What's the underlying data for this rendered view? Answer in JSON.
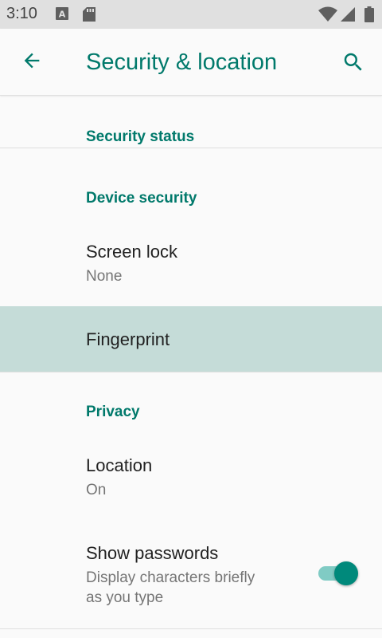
{
  "status_bar": {
    "time": "3:10",
    "notification_icons": [
      "text-a-icon",
      "sd-card-icon"
    ],
    "system_icons": [
      "wifi-icon",
      "cell-signal-icon",
      "battery-icon"
    ]
  },
  "app_bar": {
    "title": "Security & location",
    "back_icon": "arrow-back-icon",
    "search_icon": "search-icon"
  },
  "sections": {
    "security_status": {
      "header": "Security status"
    },
    "device_security": {
      "header": "Device security",
      "screen_lock": {
        "title": "Screen lock",
        "summary": "None"
      },
      "fingerprint": {
        "title": "Fingerprint"
      }
    },
    "privacy": {
      "header": "Privacy",
      "location": {
        "title": "Location",
        "summary": "On"
      },
      "show_passwords": {
        "title": "Show passwords",
        "summary_line1": "Display characters briefly",
        "summary_line2": "as you type",
        "enabled": true
      }
    }
  },
  "colors": {
    "accent": "#00796b",
    "toggle_thumb": "#00897b",
    "toggle_track": "#80cbc4",
    "highlight": "#c5dcd8"
  }
}
